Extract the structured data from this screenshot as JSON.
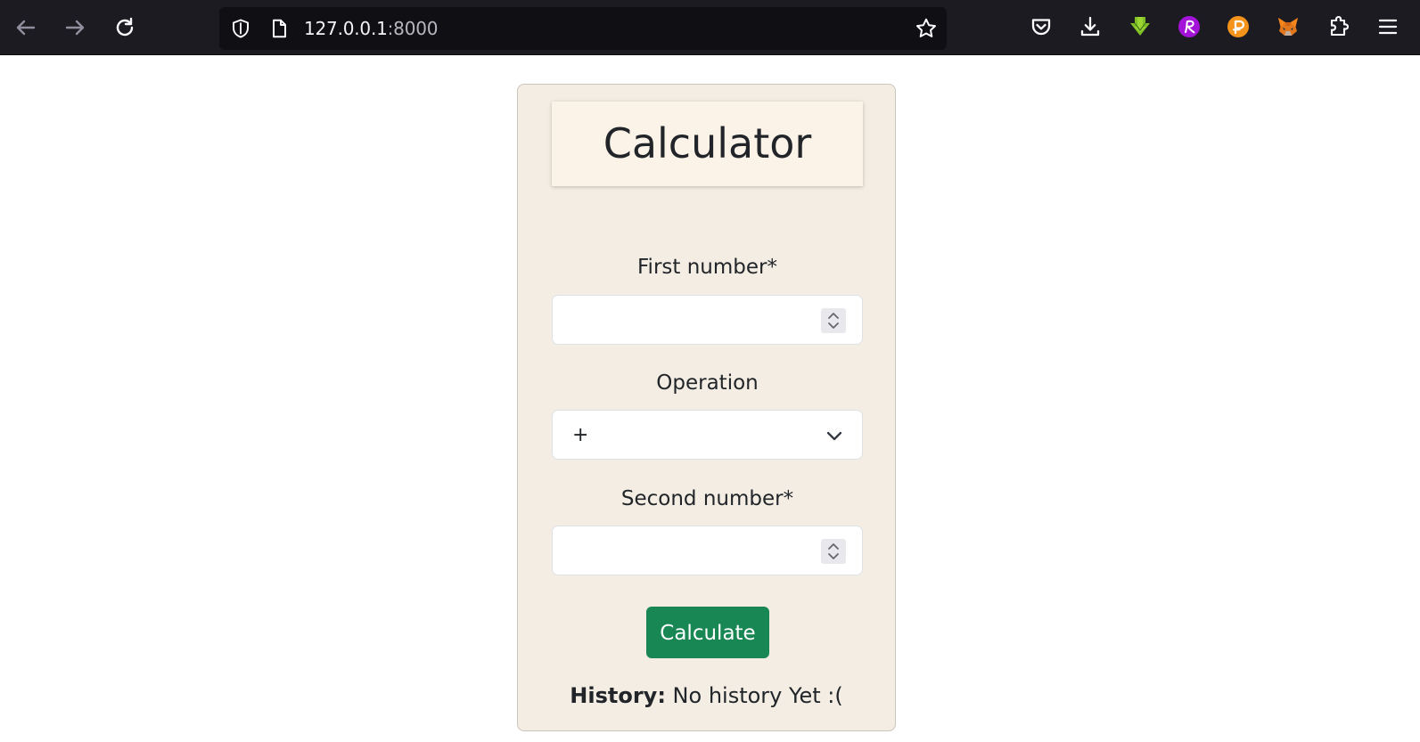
{
  "browser": {
    "url_host": "127.0.0.1",
    "url_port": ":8000",
    "icons": {
      "back": "back-arrow-icon",
      "forward": "forward-arrow-icon",
      "reload": "reload-icon",
      "shield": "shield-icon",
      "page": "page-icon",
      "bookmark": "star-icon",
      "pocket": "pocket-icon",
      "downloads": "download-icon",
      "extension_green": "green-download-extension-icon",
      "extension_r": "r-extension-icon",
      "extension_p": "p-extension-icon",
      "extension_fox": "fox-extension-icon",
      "extensions": "puzzle-icon",
      "menu": "hamburger-menu-icon"
    },
    "colors": {
      "toolbar": "#1c1b22",
      "urlbar": "#0f0f14"
    }
  },
  "app": {
    "title": "Calculator",
    "first_number": {
      "label": "First number*",
      "value": ""
    },
    "operation": {
      "label": "Operation",
      "value": "+"
    },
    "second_number": {
      "label": "Second number*",
      "value": ""
    },
    "calculate_button": "Calculate",
    "history": {
      "label": "History:",
      "value": " No history Yet :("
    },
    "colors": {
      "card_background": "#f3ede3",
      "title_background": "#fcf3e8",
      "button": "#198754"
    }
  }
}
